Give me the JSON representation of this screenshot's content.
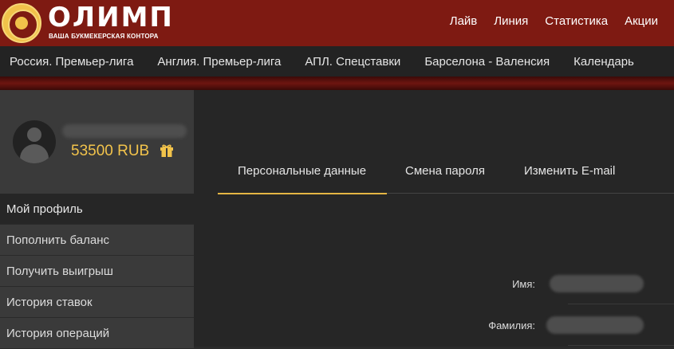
{
  "header": {
    "logo_text": "ОЛИМП",
    "logo_tagline": "ВАША БУКМЕКЕРСКАЯ КОНТОРА",
    "nav": [
      "Лайв",
      "Линия",
      "Статистика",
      "Акции"
    ]
  },
  "subnav": {
    "items": [
      "Россия. Премьер-лига",
      "Англия. Премьер-лига",
      "АПЛ. Спецставки",
      "Барселона - Валенсия",
      "Календарь"
    ]
  },
  "profile": {
    "balance": "53500 RUB"
  },
  "sidebar": {
    "items": [
      {
        "label": "Мой профиль"
      },
      {
        "label": "Пополнить баланс"
      },
      {
        "label": "Получить выигрыш"
      },
      {
        "label": "История ставок"
      },
      {
        "label": "История операций"
      }
    ]
  },
  "tabs": [
    {
      "label": "Персональные данные"
    },
    {
      "label": "Смена пароля"
    },
    {
      "label": "Изменить E-mail"
    }
  ],
  "form": {
    "first_name_label": "Имя:",
    "last_name_label": "Фамилия:"
  },
  "colors": {
    "header_bg": "#7e1a12",
    "accent_gold": "#f2c34b",
    "tab_underline": "#e5b543"
  },
  "icons": {
    "gift": "gift-icon",
    "avatar": "user-avatar-icon"
  }
}
